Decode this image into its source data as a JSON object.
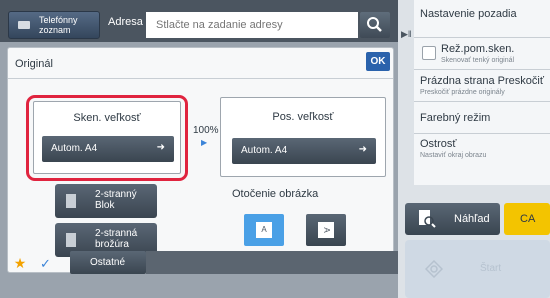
{
  "topbar": {
    "address_book_label": "Telefónny zoznam",
    "address_label": "Adresa",
    "address_placeholder": "Stlačte na zadanie adresy",
    "search_icon": "search-icon"
  },
  "dialog": {
    "title": "Originál",
    "ok_label": "OK",
    "scan_size": {
      "header": "Sken. veľkosť",
      "value": "Autom.  A4"
    },
    "ratio": "100%",
    "send_size": {
      "header": "Pos. veľkosť",
      "value": "Autom.  A4"
    },
    "duplex_block_label": "2-stranný Blok",
    "duplex_booklet_label": "2-stranná brožúra",
    "rotation_label": "Otočenie obrázka"
  },
  "right_panel": {
    "items": [
      {
        "title": "Nastavenie pozadia",
        "subtitle": ""
      },
      {
        "title": "Rež.pom.sken.",
        "subtitle": "Skenovať tenký originál"
      },
      {
        "title": "Prázdna strana Preskočiť",
        "subtitle": "Preskočiť prázdne originály"
      },
      {
        "title": "Farebný režim",
        "subtitle": ""
      },
      {
        "title": "Ostrosť",
        "subtitle": "Nastaviť okraj obrazu"
      }
    ],
    "preview_label": "Náhľad",
    "ca_label": "CA",
    "start_label": "Štart"
  },
  "bottombar": {
    "other_label": "Ostatné"
  },
  "colors": {
    "highlight": "#e0243f",
    "accent": "#3b84d8",
    "ok_blue": "#2a62ac",
    "ca_yellow": "#f3c400"
  }
}
